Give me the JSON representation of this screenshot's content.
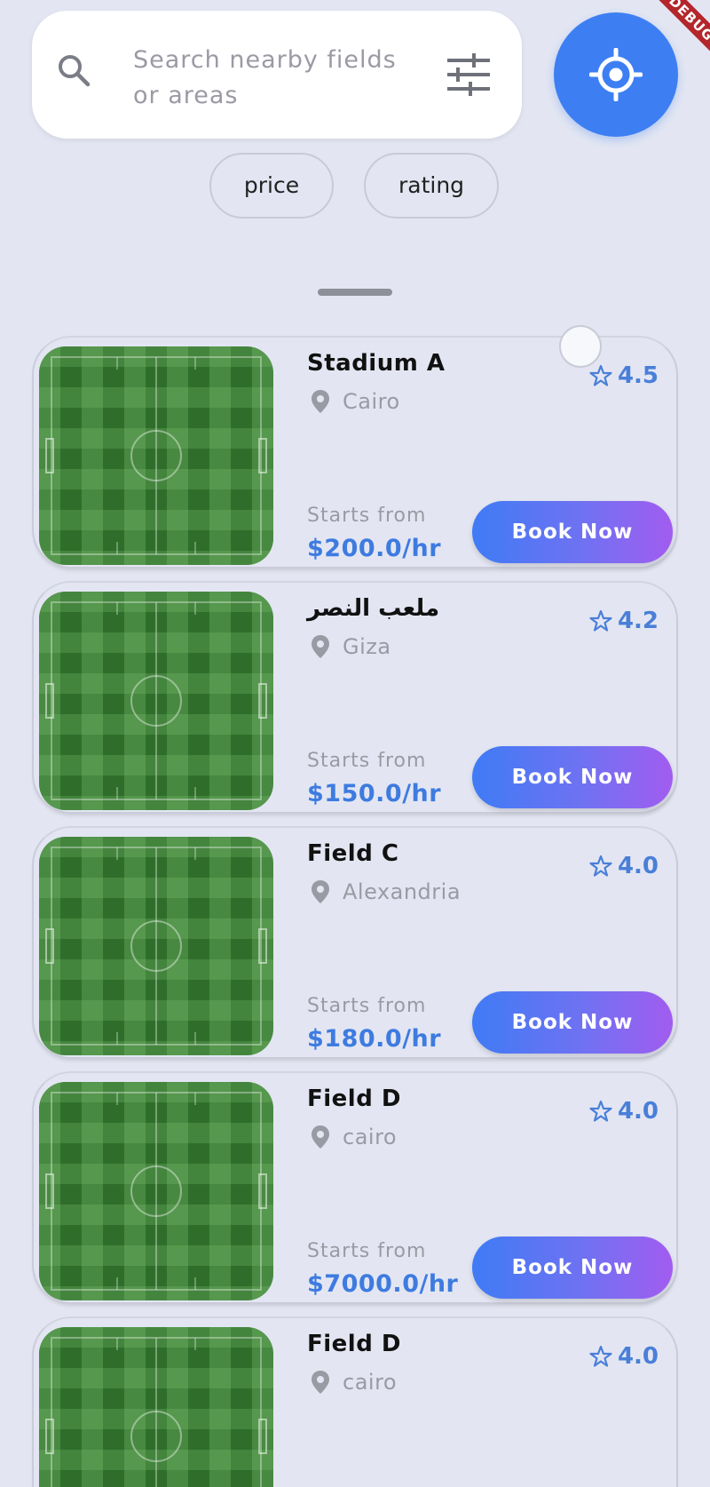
{
  "debug_banner": "DEBUG",
  "search": {
    "placeholder_line1": "Search nearby fields",
    "placeholder_line2": "or areas",
    "search_icon": "search-icon",
    "filter_icon": "tune-sliders-icon"
  },
  "location_button": {
    "icon": "gps-target-icon",
    "color": "#3D7FF3"
  },
  "sort_chips": [
    {
      "label": "price"
    },
    {
      "label": "rating"
    }
  ],
  "fields": [
    {
      "name": "Stadium A",
      "location": "Cairo",
      "rating": "4.5",
      "starts_label": "Starts from",
      "price": "$200.0/hr",
      "button": "Book Now"
    },
    {
      "name": "ملعب النصر",
      "location": "Giza",
      "rating": "4.2",
      "starts_label": "Starts from",
      "price": "$150.0/hr",
      "button": "Book Now"
    },
    {
      "name": "Field C",
      "location": "Alexandria",
      "rating": "4.0",
      "starts_label": "Starts from",
      "price": "$180.0/hr",
      "button": "Book Now"
    },
    {
      "name": "Field D",
      "location": "cairo",
      "rating": "4.0",
      "starts_label": "Starts from",
      "price": "$7000.0/hr",
      "button": "Book Now"
    },
    {
      "name": "Field D",
      "location": "cairo",
      "rating": "4.0"
    }
  ],
  "colors": {
    "background": "#E3E6F2",
    "accent_blue": "#3D7FF3",
    "price_blue": "#3E7BE0",
    "button_gradient_start": "#3F7BF5",
    "button_gradient_end": "#A25CF0"
  }
}
